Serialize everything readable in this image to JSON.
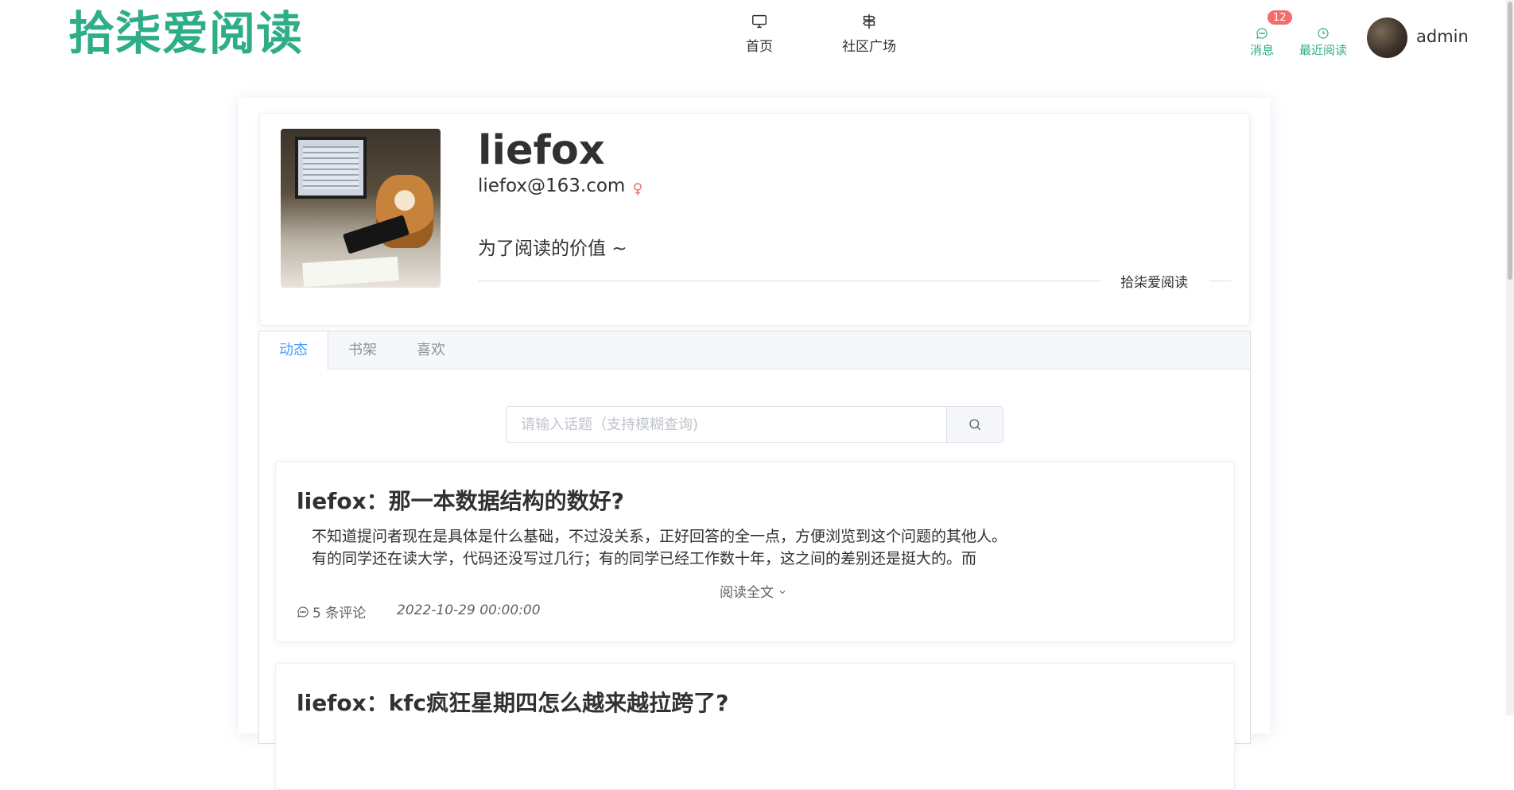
{
  "header": {
    "logo": "拾柒爱阅读",
    "nav": [
      {
        "label": "首页",
        "icon": "monitor-icon"
      },
      {
        "label": "社区广场",
        "icon": "signpost-icon"
      }
    ],
    "messages_label": "消息",
    "messages_badge": "12",
    "recent_label": "最近阅读",
    "username": "admin"
  },
  "profile": {
    "name": "liefox",
    "email": "liefox@163.com",
    "gender_icon": "female-icon",
    "motto": "为了阅读的价值 ~",
    "divider_text": "拾柒爱阅读"
  },
  "tabs": [
    {
      "label": "动态",
      "active": true
    },
    {
      "label": "书架",
      "active": false
    },
    {
      "label": "喜欢",
      "active": false
    }
  ],
  "search": {
    "placeholder": "请输入话题（支持模糊查询)"
  },
  "posts": [
    {
      "title": "liefox：那一本数据结构的数好?",
      "body_lines": [
        "不知道提问者现在是具体是什么基础，不过没关系，正好回答的全一点，方便浏览到这个问题的其他人。",
        "有的同学还在读大学，代码还没写过几行；有的同学已经工作数十年，这之间的差别还是挺大的。而"
      ],
      "read_more": "阅读全文",
      "comments": "5 条评论",
      "date": "2022-10-29 00:00:00"
    },
    {
      "title": "liefox：kfc疯狂星期四怎么越来越拉跨了?"
    }
  ],
  "colors": {
    "brand": "#2dae87",
    "tab_active": "#409eff",
    "badge": "#f56c6c",
    "female": "#f56c6c"
  }
}
